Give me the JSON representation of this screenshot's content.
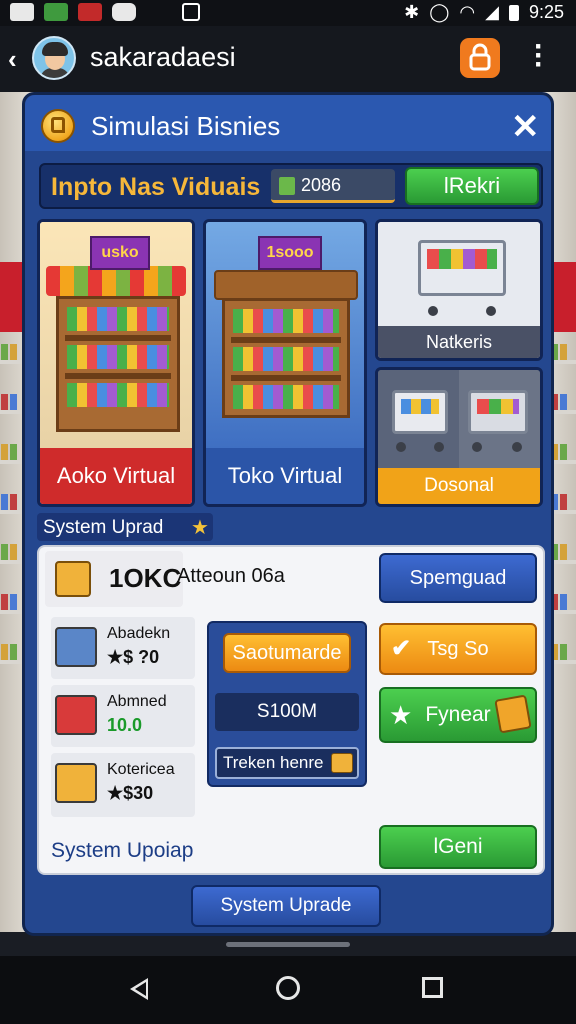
{
  "status_bar": {
    "time": "9:25",
    "icons": [
      "notification-icon",
      "photo-icon",
      "app-icon",
      "chat-icon",
      "lock-icon",
      "bluetooth-icon",
      "alarm-icon",
      "wifi-icon",
      "signal-icon",
      "battery-icon"
    ]
  },
  "app_bar": {
    "title": "sakaradaesi",
    "back_icon": "back-arrow-icon",
    "action_icon": "lock-icon",
    "menu_icon": "more-vert-icon",
    "accent": "#f07a1e"
  },
  "panel": {
    "title": "Simulasi Bisnies",
    "close": "✕",
    "strip_title": "Inpto Nas Viduais",
    "balance": "2086",
    "strip_button": "lRekri"
  },
  "stores": [
    {
      "sign": "usko",
      "label": "Aoko Virtual",
      "color": "#cf2b2b"
    },
    {
      "sign": "1sooo",
      "label": "Toko Virtual",
      "color": "#2b55a8"
    },
    {
      "label": "Natkeris"
    },
    {
      "label": "Dosonal",
      "color": "#f1a318"
    }
  ],
  "system_tag": "System Uprad",
  "card": {
    "big_value": "1OKC",
    "big_desc": "Atteoun 06a",
    "items": [
      {
        "name": "Abadekn",
        "value": "★$ ?0",
        "value_color": "#111111"
      },
      {
        "name": "Abmned",
        "value": "10.0",
        "value_color": "#1a9a2a"
      },
      {
        "name": "Kotericea",
        "value": "★$30",
        "value_color": "#111111"
      }
    ],
    "mid_button": "Saotumarde",
    "mid_value": "S100M",
    "mid_chip": "Treken henre",
    "btn_blue": "Spemguad",
    "btn_orange": "Tsg So",
    "btn_green": "Fynear",
    "btn_bottom": "lGeni",
    "footer_label": "System Upoiap"
  },
  "bottom_button": "System Uprade"
}
